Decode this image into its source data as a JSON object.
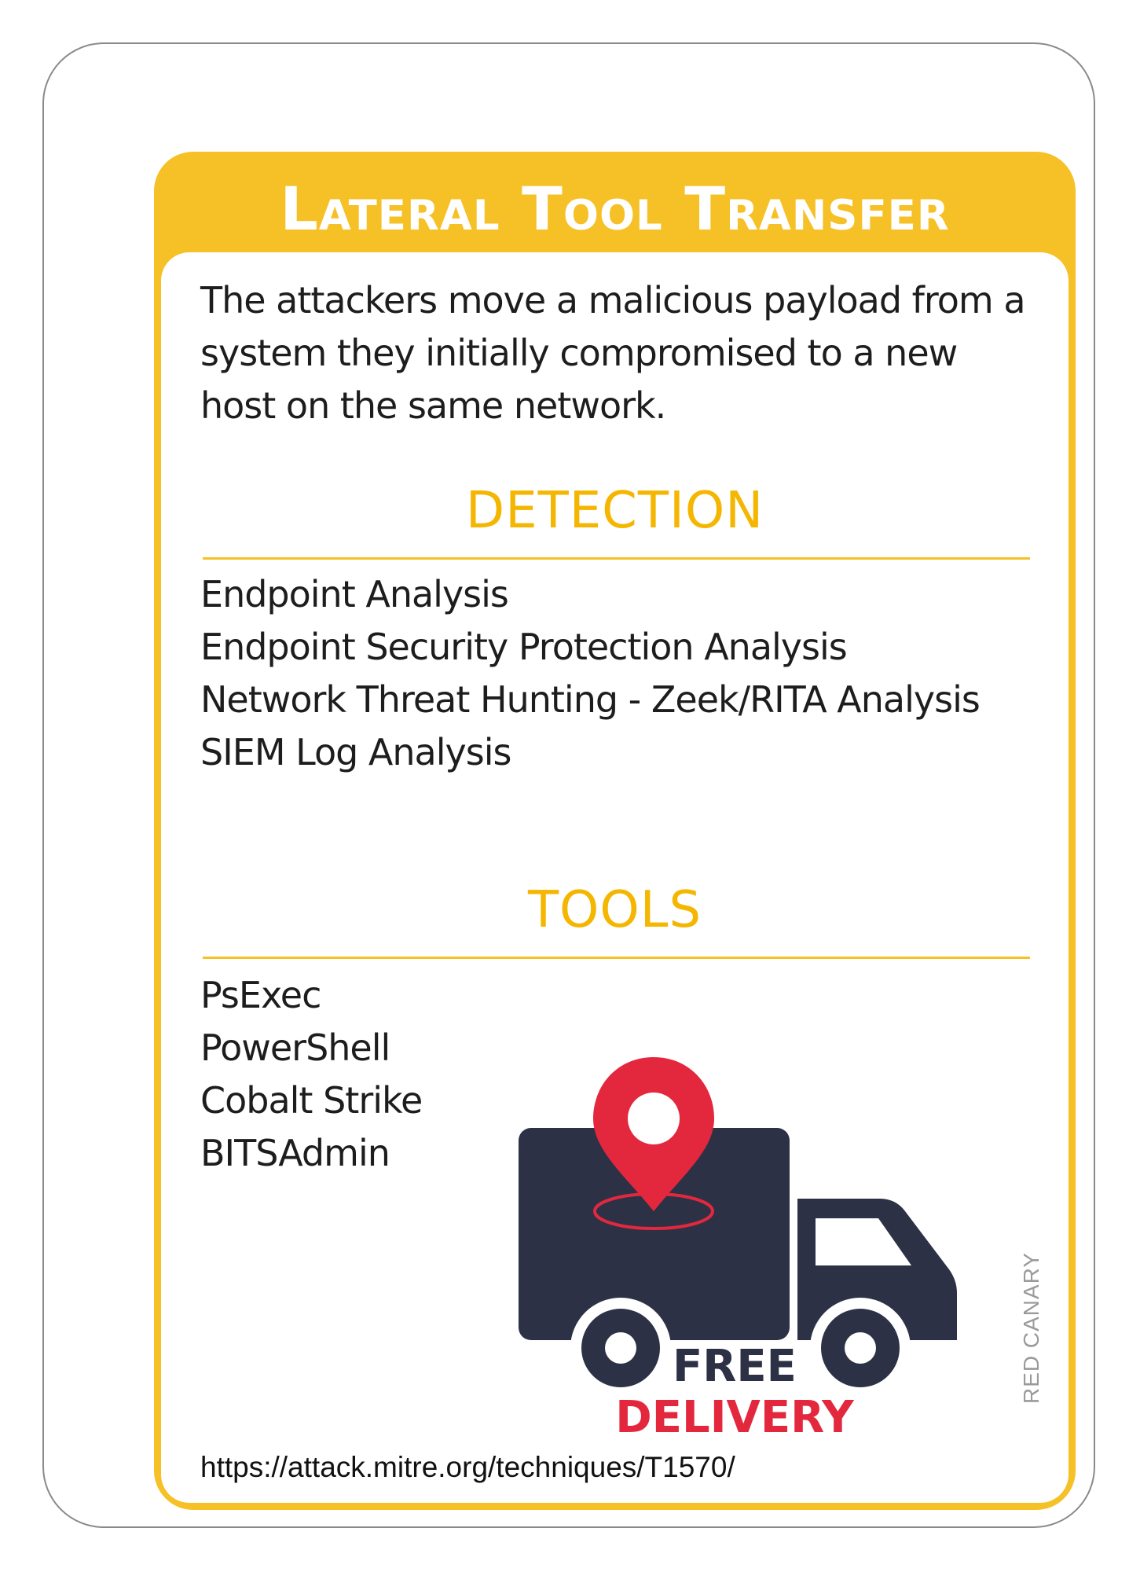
{
  "card": {
    "title": "Lateral Tool Transfer",
    "description": "The attackers move a malicious payload from a system they initially compromised to a new host on the same network.",
    "detection": {
      "heading": "DETECTION",
      "items": [
        "Endpoint Analysis",
        "Endpoint Security Protection Analysis",
        "Network Threat Hunting - Zeek/RITA Analysis",
        "SIEM Log Analysis"
      ]
    },
    "tools": {
      "heading": "TOOLS",
      "items": [
        "PsExec",
        "PowerShell",
        "Cobalt Strike",
        "BITSAdmin"
      ]
    },
    "illustration": {
      "icon": "delivery-truck-icon",
      "free_label": "FREE",
      "delivery_label": "DELIVERY"
    },
    "url": "https://attack.mitre.org/techniques/T1570/",
    "brand": "RED CANARY"
  },
  "colors": {
    "accent": "#f6c027",
    "heading": "#f4b600",
    "truck": "#2d3146",
    "pin": "#e3283e"
  }
}
